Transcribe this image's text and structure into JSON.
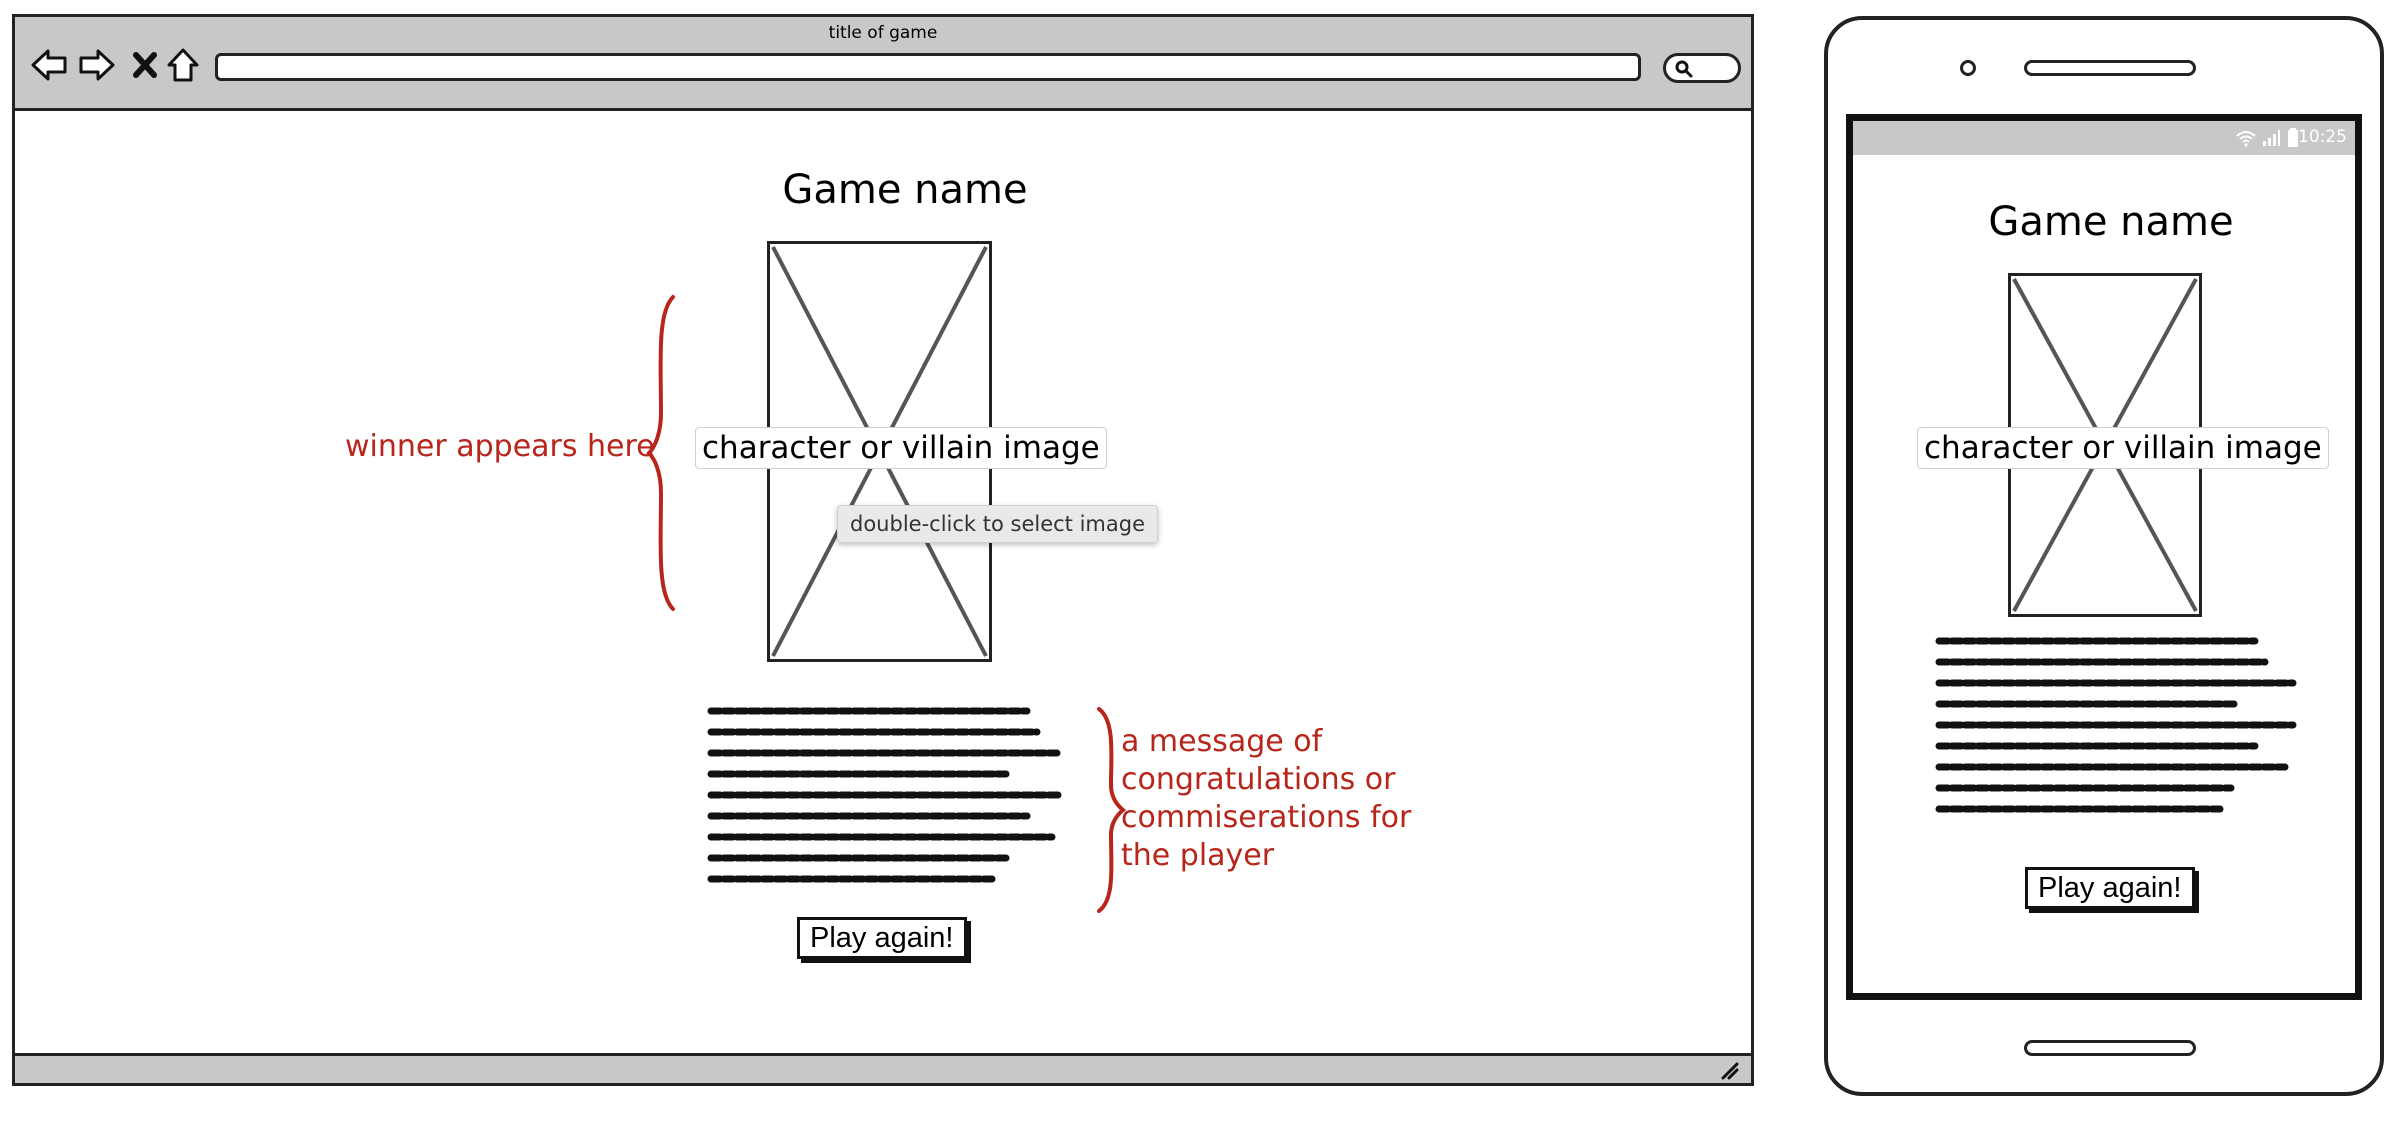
{
  "browser": {
    "window_title": "title of game",
    "nav_icons": [
      "back-arrow-icon",
      "forward-arrow-icon",
      "close-x-icon",
      "home-icon"
    ],
    "search_icon": "search-icon",
    "resize_icon": "resize-grip-icon",
    "game_name": "Game name",
    "image_label": "character or villain image",
    "image_tooltip": "double-click to select image",
    "play_again_label": "Play again!",
    "annotations": {
      "winner": "winner appears here",
      "message_lines": [
        "a message of",
        "congratulations or",
        "commiserations for",
        "the player"
      ]
    }
  },
  "phone": {
    "status_time": "10:25",
    "status_icons": [
      "wifi-icon",
      "signal-icon",
      "battery-icon"
    ],
    "game_name": "Game name",
    "image_label": "character or villain image",
    "play_again_label": "Play again!"
  },
  "colors": {
    "annotation": "#b8251a",
    "chrome": "#c8c8c8",
    "stroke": "#222222"
  }
}
